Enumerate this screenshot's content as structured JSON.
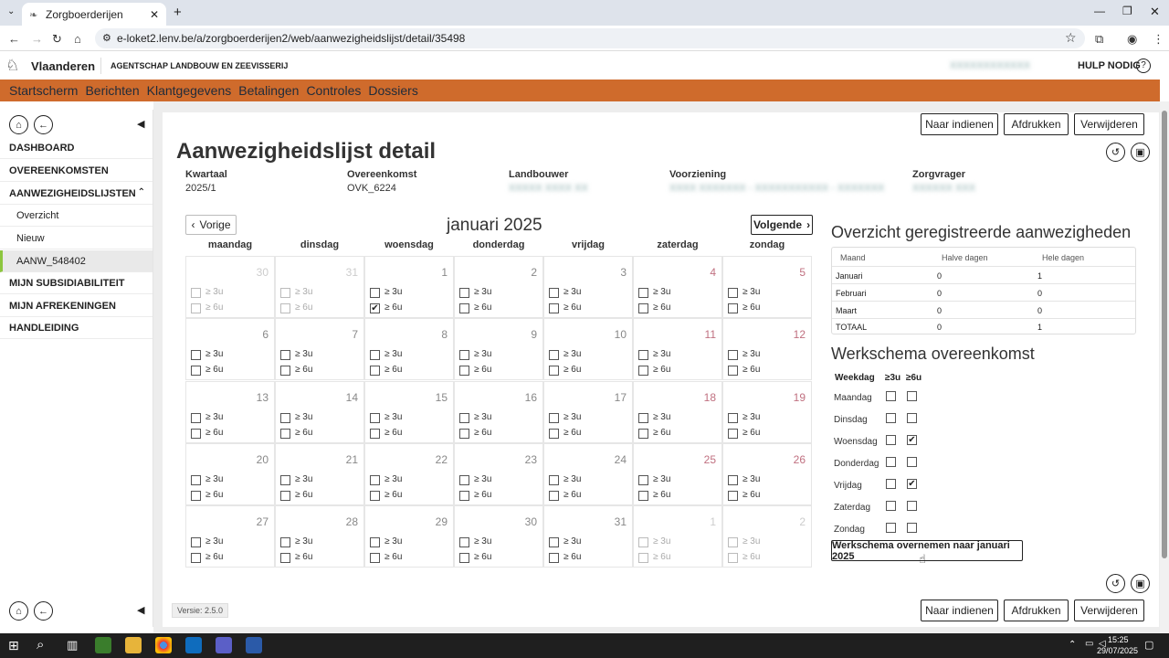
{
  "browser": {
    "tab_title": "Zorgboerderijen",
    "url": "e-loket2.lenv.be/a/zorgboerderijen2/web/aanwezigheidslijst/detail/35498"
  },
  "site": {
    "brand": "Vlaanderen",
    "agency": "AGENTSCHAP LANDBOUW EN ZEEVISSERIJ",
    "help": "HULP NODIG",
    "help_icon": "?",
    "user": "XXXXXXXXXXXX"
  },
  "nav": [
    "Startscherm",
    "Berichten",
    "Klantgegevens",
    "Betalingen",
    "Controles",
    "Dossiers"
  ],
  "sidebar": {
    "items": [
      "DASHBOARD",
      "OVEREENKOMSTEN",
      "AANWEZIGHEIDSLIJSTEN",
      "Overzicht",
      "Nieuw",
      "AANW_548402",
      "MIJN SUBSIDIABILITEIT",
      "MIJN AFREKENINGEN",
      "HANDLEIDING"
    ]
  },
  "actions": {
    "submit": "Naar indienen",
    "print": "Afdrukken",
    "delete": "Verwijderen"
  },
  "page": {
    "title": "Aanwezigheidslijst detail",
    "version": "Versie: 2.5.0"
  },
  "meta": [
    {
      "label": "Kwartaal",
      "value": "2025/1"
    },
    {
      "label": "Overeenkomst",
      "value": "OVK_6224"
    },
    {
      "label": "Landbouwer",
      "value": "XXXXX XXXX XX"
    },
    {
      "label": "Voorziening",
      "value": "XXXX XXXXXXX - XXXXXXXXXXX - XXXXXXX"
    },
    {
      "label": "Zorgvrager",
      "value": "XXXXXX XXX"
    }
  ],
  "calendar": {
    "prev": "Vorige",
    "next": "Volgende",
    "month": "januari 2025",
    "weekdays": [
      "maandag",
      "dinsdag",
      "woensdag",
      "donderdag",
      "vrijdag",
      "zaterdag",
      "zondag"
    ],
    "opt3": "≥ 3u",
    "opt6": "≥ 6u",
    "days": [
      "30",
      "31",
      "1",
      "2",
      "3",
      "4",
      "5",
      "6",
      "7",
      "8",
      "9",
      "10",
      "11",
      "12",
      "13",
      "14",
      "15",
      "16",
      "17",
      "18",
      "19",
      "20",
      "21",
      "22",
      "23",
      "24",
      "25",
      "26",
      "27",
      "28",
      "29",
      "30",
      "31",
      "1",
      "2"
    ],
    "checked_6u": [
      "1"
    ]
  },
  "overview": {
    "title": "Overzicht geregistreerde aanwezigheden",
    "headers": [
      "Maand",
      "Halve dagen",
      "Hele dagen"
    ],
    "rows": [
      [
        "Januari",
        "0",
        "1"
      ],
      [
        "Februari",
        "0",
        "0"
      ],
      [
        "Maart",
        "0",
        "0"
      ],
      [
        "TOTAAL",
        "0",
        "1"
      ]
    ]
  },
  "schedule": {
    "title": "Werkschema overeenkomst",
    "headers": [
      "Weekdag",
      "≥3u",
      "≥6u"
    ],
    "rows": [
      {
        "day": "Maandag",
        "h3": false,
        "h6": false
      },
      {
        "day": "Dinsdag",
        "h3": false,
        "h6": false
      },
      {
        "day": "Woensdag",
        "h3": false,
        "h6": true
      },
      {
        "day": "Donderdag",
        "h3": false,
        "h6": false
      },
      {
        "day": "Vrijdag",
        "h3": false,
        "h6": true
      },
      {
        "day": "Zaterdag",
        "h3": false,
        "h6": false
      },
      {
        "day": "Zondag",
        "h3": false,
        "h6": false
      }
    ],
    "apply": "Werkschema overnemen naar januari 2025"
  },
  "taskbar": {
    "time": "15:25",
    "date": "29/07/2025"
  }
}
